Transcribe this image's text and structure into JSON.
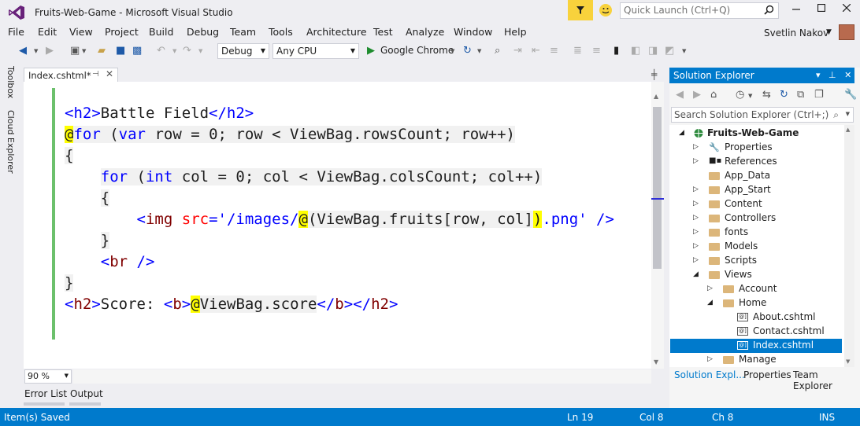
{
  "window": {
    "title": "Fruits-Web-Game - Microsoft Visual Studio",
    "quick_launch_placeholder": "Quick Launch (Ctrl+Q)",
    "user_name": "Svetlin Nakov"
  },
  "menu": [
    "File",
    "Edit",
    "View",
    "Project",
    "Build",
    "Debug",
    "Team",
    "Tools",
    "Architecture",
    "Test",
    "Analyze",
    "Window",
    "Help"
  ],
  "toolbar": {
    "configuration": "Debug",
    "platform": "Any CPU",
    "run_target": "Google Chrome"
  },
  "left_tabs": [
    "Toolbox",
    "Cloud Explorer"
  ],
  "document": {
    "tab_label": "Index.cshtml*",
    "zoom": "90 %"
  },
  "code": {
    "l1": [
      "<h2>",
      "Battle Field",
      "</h2>"
    ],
    "l2": [
      "@",
      "for",
      " (",
      "var",
      " row = 0; row < ViewBag.rowsCount; row++)"
    ],
    "l3": "{",
    "l4": [
      "for",
      " (",
      "int",
      " col = 0; col < ViewBag.colsCount; col++)"
    ],
    "l5": "{",
    "l6": [
      "<",
      "img",
      " ",
      "src",
      "=",
      "'/images/",
      "@",
      "(ViewBag.fruits[row, col]",
      ")",
      ".png'",
      " ",
      "/>"
    ],
    "l7": "}",
    "l8": [
      "<",
      "br",
      " />"
    ],
    "l9": "}",
    "l10": [
      "<",
      "h2",
      ">",
      "Score: ",
      "<",
      "b",
      ">",
      "@",
      "ViewBag.score",
      "</",
      "b",
      "></",
      "h2",
      ">"
    ]
  },
  "bottom_tabs": [
    "Error List",
    "Output"
  ],
  "status": {
    "message": "Item(s) Saved",
    "line": "Ln 19",
    "col": "Col 8",
    "ch": "Ch 8",
    "mode": "INS"
  },
  "solution_explorer": {
    "title": "Solution Explorer",
    "search_placeholder": "Search Solution Explorer (Ctrl+;)",
    "project": "Fruits-Web-Game",
    "items": [
      {
        "label": "Properties",
        "icon": "wrench-icon"
      },
      {
        "label": "References",
        "icon": "references-icon"
      },
      {
        "label": "App_Data",
        "icon": "folder-icon"
      },
      {
        "label": "App_Start",
        "icon": "folder-icon"
      },
      {
        "label": "Content",
        "icon": "folder-icon"
      },
      {
        "label": "Controllers",
        "icon": "folder-icon"
      },
      {
        "label": "fonts",
        "icon": "folder-icon"
      },
      {
        "label": "Models",
        "icon": "folder-icon"
      },
      {
        "label": "Scripts",
        "icon": "folder-icon"
      },
      {
        "label": "Views",
        "icon": "folder-icon"
      },
      {
        "label": "Account",
        "icon": "folder-icon"
      },
      {
        "label": "Home",
        "icon": "folder-icon"
      },
      {
        "label": "About.cshtml",
        "icon": "cshtml-icon"
      },
      {
        "label": "Contact.cshtml",
        "icon": "cshtml-icon"
      },
      {
        "label": "Index.cshtml",
        "icon": "cshtml-icon"
      },
      {
        "label": "Manage",
        "icon": "folder-icon"
      }
    ],
    "bottom_tabs": [
      "Solution Expl...",
      "Properties",
      "Team Explorer"
    ]
  },
  "colors": {
    "accent": "#007acc",
    "filter_badge": "#f8d23c",
    "razor_highlight": "#ffff00",
    "change_bar": "#6cc06c"
  }
}
